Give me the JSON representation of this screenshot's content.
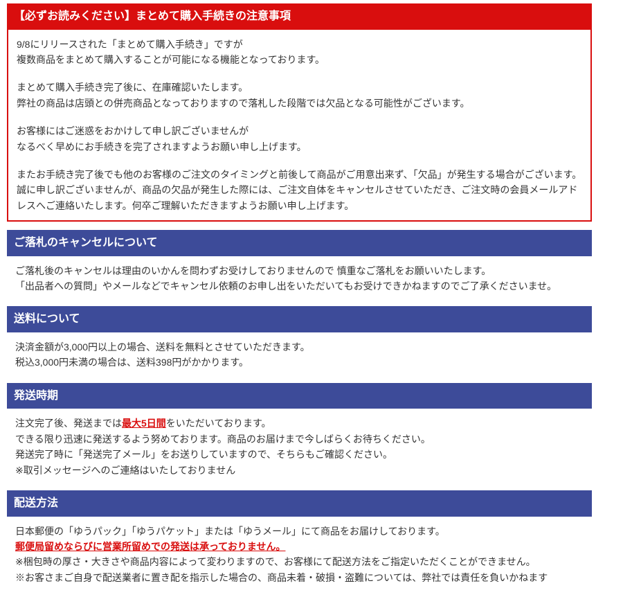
{
  "section1": {
    "title": "【必ずお読みください】まとめて購入手続きの注意事項",
    "p1a": "9/8にリリースされた「まとめて購入手続き」ですが",
    "p1b": "複数商品をまとめて購入することが可能になる機能となっております。",
    "p2a": "まとめて購入手続き完了後に、在庫確認いたします。",
    "p2b": "弊社の商品は店頭との併売商品となっておりますので落札した段階では欠品となる可能性がございます。",
    "p3a": "お客様にはご迷惑をおかけして申し訳ございませんが",
    "p3b": "なるべく早めにお手続きを完了されますようお願い申し上げます。",
    "p4a": "またお手続き完了後でも他のお客様のご注文のタイミングと前後して商品がご用意出来ず、「欠品」が発生する場合がございます。",
    "p4b": "誠に申し訳ございませんが、商品の欠品が発生した際には、ご注文自体をキャンセルさせていただき、ご注文時の会員メールアドレスへご連絡いたします。何卒ご理解いただきますようお願い申し上げます。"
  },
  "section2": {
    "title": "ご落札のキャンセルについて",
    "p1a": "ご落札後のキャンセルは理由のいかんを問わずお受けしておりませんので 慎重なご落札をお願いいたします。",
    "p1b": "「出品者への質問」やメールなどでキャンセル依頼のお申し出をいただいてもお受けできかねますのでご了承くださいませ。"
  },
  "section3": {
    "title": "送料について",
    "p1a": "決済金額が3,000円以上の場合、送料を無料とさせていただきます。",
    "p1b": "税込3,000円未満の場合は、送料398円がかかります。"
  },
  "section4": {
    "title": "発送時期",
    "p1_before": "注文完了後、発送までは",
    "p1_em": "最大5日間",
    "p1_after": "をいただいております。",
    "p2": "できる限り迅速に発送するよう努めております。商品のお届けまで今しばらくお待ちください。",
    "p3": "発送完了時に「発送完了メール」をお送りしていますので、そちらもご確認ください。",
    "p4": "※取引メッセージへのご連絡はいたしておりません"
  },
  "section5": {
    "title": "配送方法",
    "p1": "日本郵便の「ゆうパック」「ゆうパケット」または「ゆうメール」にて商品をお届けしております。",
    "p2_em": "郵便局留めならびに営業所留めでの発送は承っておりません。",
    "p3": "※梱包時の厚さ・大きさや商品内容によって変わりますので、お客様にて配送方法をご指定いただくことができません。",
    "p4": "※お客さまご自身で配送業者に置き配を指示した場合の、商品未着・破損・盗難については、弊社では責任を負いかねます"
  }
}
